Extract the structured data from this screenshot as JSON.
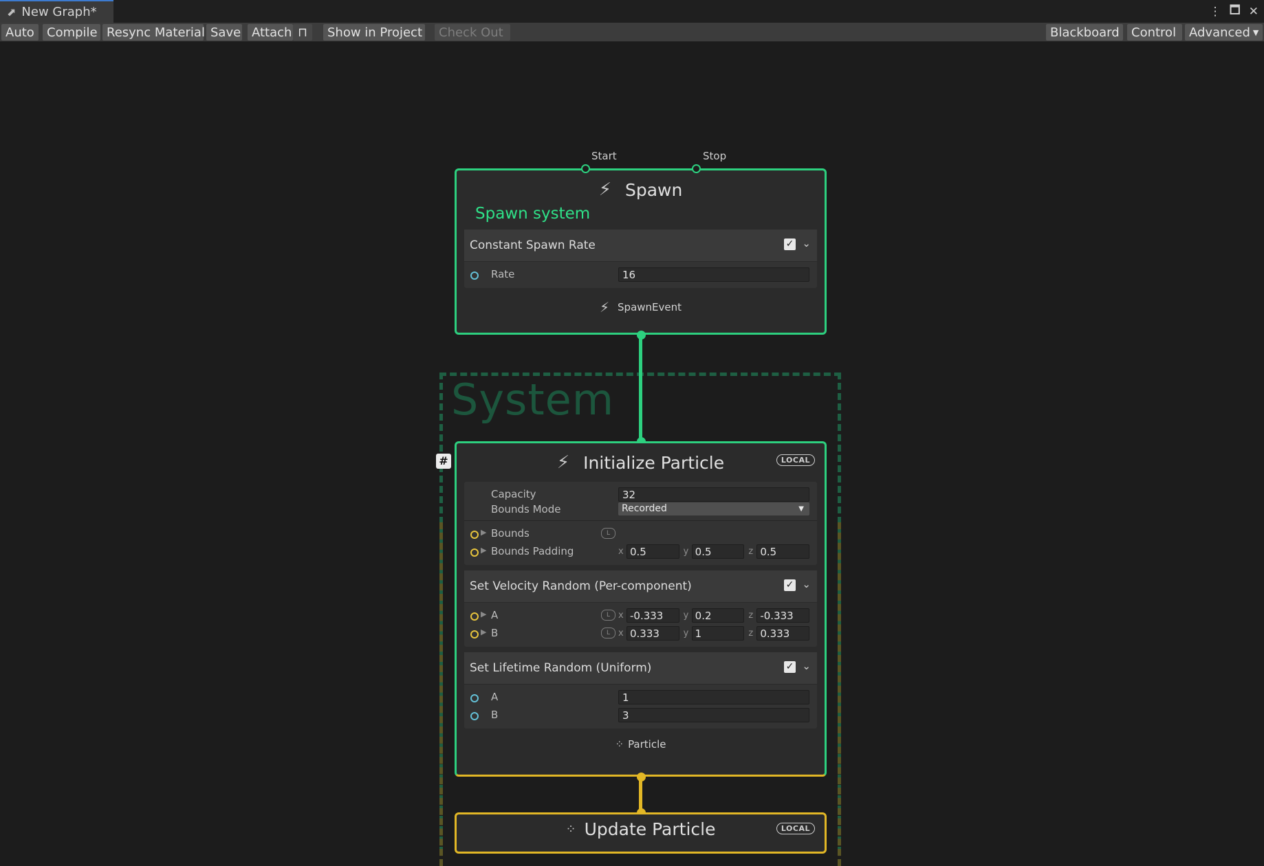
{
  "window": {
    "tab_title": "New Graph*",
    "controls": [
      "⋮",
      "🗖",
      "✕"
    ]
  },
  "toolbar": {
    "auto": "Auto",
    "compile": "Compile",
    "resync": "Resync Material",
    "save": "Save",
    "attach": "Attach",
    "show_in_project": "Show in Project",
    "check_out": "Check Out",
    "blackboard": "Blackboard",
    "control": "Control",
    "advanced": "Advanced"
  },
  "spawn": {
    "title": "Spawn",
    "subtitle": "Spawn system",
    "start_label": "Start",
    "stop_label": "Stop",
    "block": {
      "title": "Constant Spawn Rate",
      "enabled": true,
      "rate_label": "Rate",
      "rate_value": "16"
    },
    "output_label": "SpawnEvent"
  },
  "system": {
    "label": "System"
  },
  "initialize": {
    "title": "Initialize Particle",
    "space_badge": "LOCAL",
    "capacity_label": "Capacity",
    "capacity_value": "32",
    "bounds_mode_label": "Bounds Mode",
    "bounds_mode_value": "Recorded",
    "bounds_label": "Bounds",
    "bounds_padding_label": "Bounds Padding",
    "bounds_padding": {
      "x": "0.5",
      "y": "0.5",
      "z": "0.5"
    },
    "velocity_block": {
      "title": "Set Velocity Random (Per-component)",
      "enabled": true,
      "a_label": "A",
      "a": {
        "x": "-0.333",
        "y": "0.2",
        "z": "-0.333"
      },
      "b_label": "B",
      "b": {
        "x": "0.333",
        "y": "1",
        "z": "0.333"
      }
    },
    "lifetime_block": {
      "title": "Set Lifetime Random (Uniform)",
      "enabled": true,
      "a_label": "A",
      "a_value": "1",
      "b_label": "B",
      "b_value": "3"
    },
    "output_label": "Particle"
  },
  "update": {
    "title": "Update Particle",
    "space_badge": "LOCAL"
  },
  "colors": {
    "spawn_border": "#2dd07f",
    "particle_border": "#e2b726",
    "system_frame": "#1e5f43"
  }
}
